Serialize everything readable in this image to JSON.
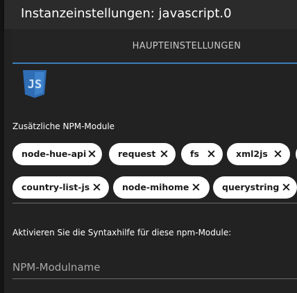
{
  "dialog": {
    "title": "Instanzeinstellungen: javascript.0"
  },
  "tabs": [
    {
      "label": "HAUPTEINSTELLUNGEN",
      "active": true
    }
  ],
  "logo": {
    "text": "JS",
    "color": "#2f6db5"
  },
  "modules": {
    "label": "Zusätzliche NPM-Module",
    "chips": [
      "node-hue-api",
      "request",
      "fs",
      "xml2js",
      "country-list-js",
      "node-mihome",
      "querystring"
    ]
  },
  "syntax": {
    "label": "Aktivieren Sie die Syntaxhilfe für diese npm-Module:",
    "placeholder": "NPM-Modulname"
  },
  "colors": {
    "accent": "#3a7fb8",
    "chip_bg": "#ffffff",
    "background": "#222222"
  }
}
